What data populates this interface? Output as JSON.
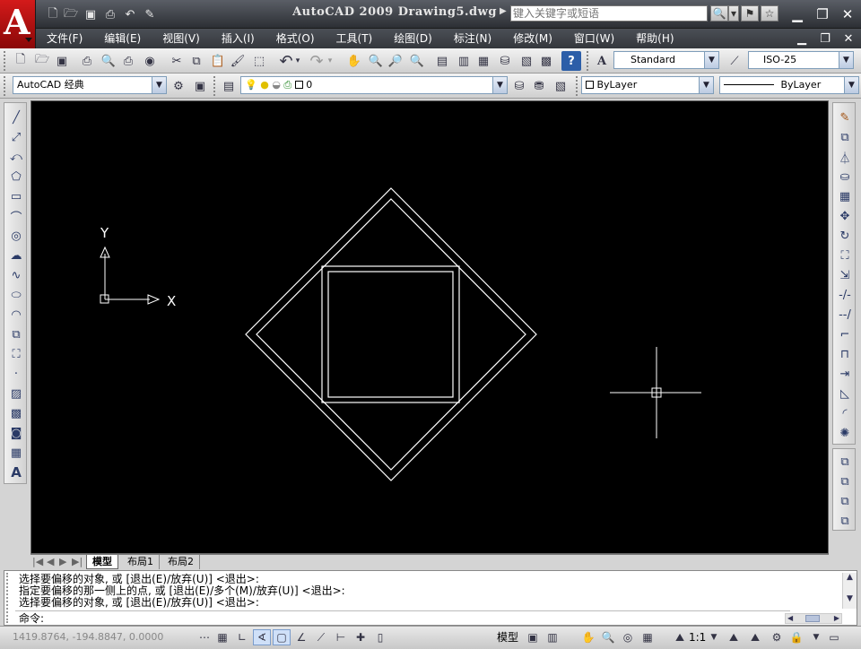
{
  "window": {
    "title": "AutoCAD 2009  Drawing5.dwg",
    "search_placeholder": "键入关键字或短语"
  },
  "icons": {
    "app_logo": "A",
    "quick": [
      "new-icon",
      "open-icon",
      "save-icon",
      "plot-icon",
      "undo-icon",
      "workspace-icon"
    ]
  },
  "menu": {
    "items": [
      "文件(F)",
      "编辑(E)",
      "视图(V)",
      "插入(I)",
      "格式(O)",
      "工具(T)",
      "绘图(D)",
      "标注(N)",
      "修改(M)",
      "窗口(W)",
      "帮助(H)"
    ]
  },
  "toolbar": {
    "text_style": "Standard",
    "dim_style": "ISO-25",
    "workspace": "AutoCAD 经典",
    "layer": "0",
    "color": "ByLayer",
    "linetype": "ByLayer"
  },
  "canvas": {
    "ucs_x": "X",
    "ucs_y": "Y"
  },
  "tabs": [
    "模型",
    "布局1",
    "布局2"
  ],
  "command": {
    "lines": [
      "选择要偏移的对象, 或 [退出(E)/放弃(U)] <退出>:",
      "指定要偏移的那一侧上的点, 或 [退出(E)/多个(M)/放弃(U)] <退出>:",
      "选择要偏移的对象, 或 [退出(E)/放弃(U)] <退出>:"
    ],
    "prompt": "命令:"
  },
  "status": {
    "coords": "1419.8764, -194.8847, 0.0000",
    "model": "模型",
    "scale": "1:1"
  },
  "colors": {
    "canvas_bg": "#000000",
    "geometry": "#ffffff",
    "title_bg": "#3a3d42"
  }
}
